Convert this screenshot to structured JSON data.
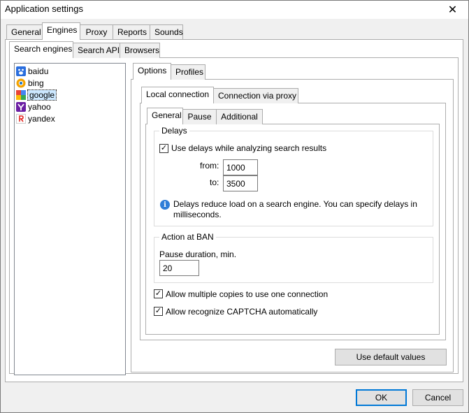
{
  "window": {
    "title": "Application settings",
    "close_glyph": "✕"
  },
  "top_tabs": [
    {
      "label": "General"
    },
    {
      "label": "Engines"
    },
    {
      "label": "Proxy"
    },
    {
      "label": "Reports"
    },
    {
      "label": "Sounds"
    }
  ],
  "engine_tabs": [
    {
      "label": "Search engines"
    },
    {
      "label": "Search API"
    },
    {
      "label": "Browsers"
    }
  ],
  "engines_list": [
    {
      "label": "baidu",
      "icon": "baidu-icon"
    },
    {
      "label": "bing",
      "icon": "bing-icon"
    },
    {
      "label": "google",
      "icon": "google-icon",
      "selected": true
    },
    {
      "label": "yahoo",
      "icon": "yahoo-icon"
    },
    {
      "label": "yandex",
      "icon": "yandex-icon"
    }
  ],
  "option_tabs": [
    {
      "label": "Options"
    },
    {
      "label": "Profiles"
    }
  ],
  "connection_tabs": [
    {
      "label": "Local connection"
    },
    {
      "label": "Connection via proxy"
    }
  ],
  "sub_tabs": [
    {
      "label": "General"
    },
    {
      "label": "Pause"
    },
    {
      "label": "Additional"
    }
  ],
  "delays": {
    "group_label": "Delays",
    "use_delays_label": "Use delays while analyzing search results",
    "use_delays_checked": true,
    "from_label": "from:",
    "from_value": "1000",
    "to_label": "to:",
    "to_value": "3500",
    "info_text_line1": "Delays reduce load on a search engine. You can specify delays in",
    "info_text_line2": "milliseconds."
  },
  "ban": {
    "group_label": "Action at BAN",
    "pause_label": "Pause duration, min.",
    "pause_value": "20"
  },
  "options": {
    "multiple_copies_label": "Allow multiple copies to use one connection",
    "multiple_copies_checked": true,
    "captcha_label": "Allow recognize CAPTCHA automatically",
    "captcha_checked": true
  },
  "buttons": {
    "default_values": "Use default values",
    "ok": "OK",
    "cancel": "Cancel"
  },
  "colors": {
    "accent": "#0078d7",
    "selection": "#cce8ff",
    "info": "#2f7ed8"
  }
}
